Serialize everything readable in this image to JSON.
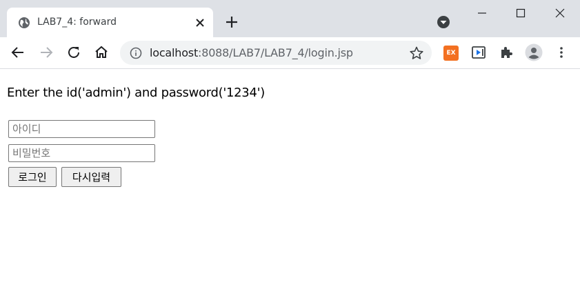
{
  "browser": {
    "tab": {
      "title": "LAB7_4: forward",
      "favicon": "globe-icon"
    },
    "url": {
      "host": "localhost",
      "path": ":8088/LAB7/LAB7_4/login.jsp"
    },
    "extensions": {
      "ex_label": "EX"
    }
  },
  "page": {
    "heading": "Enter the id('admin') and password('1234')",
    "id_field": {
      "placeholder": "아이디",
      "value": ""
    },
    "password_field": {
      "placeholder": "비밀번호",
      "value": ""
    },
    "login_button": "로그인",
    "reset_button": "다시입력"
  },
  "colors": {
    "tabstrip": "#dee1e6",
    "omnibox": "#f1f3f4",
    "ext_orange": "#f37021"
  }
}
